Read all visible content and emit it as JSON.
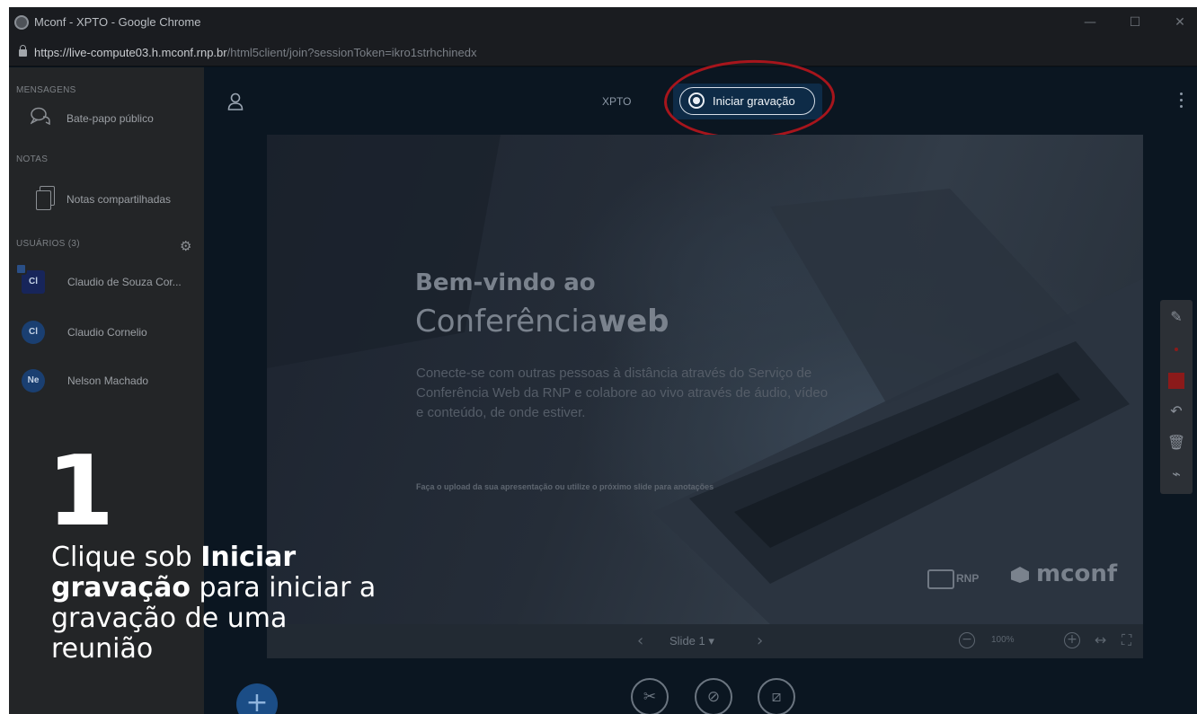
{
  "window": {
    "title": "Mconf - XPTO - Google Chrome",
    "minimize_glyph": "—",
    "maximize_glyph": "☐",
    "close_glyph": "✕"
  },
  "address": {
    "host": "https://live-compute03.h.mconf.rnp.br",
    "path": "/html5client/join?sessionToken=ikro1strhchinedx"
  },
  "sidebar": {
    "messages_title": "MENSAGENS",
    "public_chat": "Bate-papo público",
    "notes_title": "NOTAS",
    "shared_notes": "Notas compartilhadas",
    "users_title": "USUÁRIOS (3)",
    "users": [
      {
        "initials": "Cl",
        "name": "Claudio de Souza Cor..."
      },
      {
        "initials": "Cl",
        "name": "Claudio Cornelio"
      },
      {
        "initials": "Ne",
        "name": "Nelson Machado"
      }
    ]
  },
  "header": {
    "meeting_name": "XPTO",
    "record_label": "Iniciar gravação"
  },
  "slide": {
    "title_line1": "Bem-vindo ao",
    "title_line2_light": "Conferência",
    "title_line2_bold": "web",
    "body": "Conecte-se com outras pessoas à distância através do Serviço de Conferência Web da RNP e colabore ao vivo através de áudio, vídeo e conteúdo, de onde estiver.",
    "footer_note": "Faça o upload da sua apresentação ou utilize o próximo slide para anotações",
    "logo_rnp": "RNP",
    "logo_mconf": "mconf"
  },
  "slide_nav": {
    "prev": "‹",
    "next": "›",
    "current": "Slide 1",
    "zoom": "100%",
    "zoom_out": "−",
    "zoom_in": "+",
    "fit": "↔",
    "fullscreen": "⛶"
  },
  "tools": {
    "pencil": "✎",
    "undo": "↶",
    "trash": "🗑",
    "chart": "⌁",
    "tool_color": "#8b1a1a"
  },
  "actions": {
    "mute": "✂",
    "camera": "⊘",
    "share": "⧄",
    "plus": "+"
  },
  "tutorial": {
    "step": "1",
    "text_prefix": "Clique sob ",
    "text_bold": "Iniciar gravação",
    "text_suffix": " para iniciar a gravação de uma reunião"
  },
  "colors": {
    "highlight": "#a7151c",
    "record_bg": "#0e2b47"
  }
}
